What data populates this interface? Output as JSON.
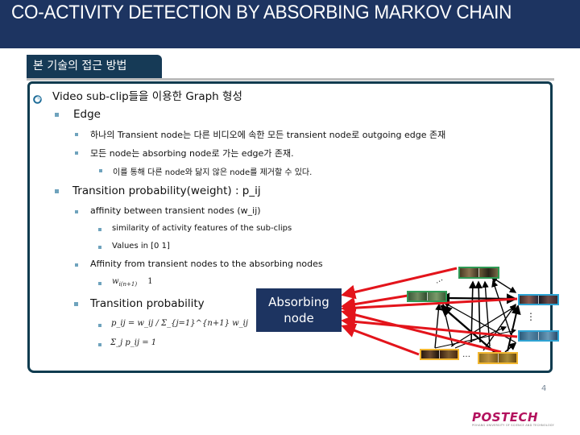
{
  "header": {
    "title": "CO-ACTIVITY DETECTION BY ABSORBING MARKOV CHAIN"
  },
  "section": {
    "tab_label": "본 기술의 접근 방법"
  },
  "content": {
    "main_bullet": "Video sub-clip들을 이용한 Graph 형성",
    "edge": {
      "label": "Edge",
      "items": [
        "하나의 Transient node는 다른 비디오에 속한 모든 transient node로 outgoing edge 존재",
        "모든 node는 absorbing node로 가는 edge가 존재."
      ],
      "sub_items": [
        "이를 통해 다른 node와 닮지 않은 node를 제거할 수 있다."
      ]
    },
    "transition_weight": {
      "label": "Transition probability(weight) : p_ij",
      "affinity_transient": "affinity between transient nodes (w_ij)",
      "affinity_sub": [
        "similarity of activity features of the sub-clips",
        "Values in [0 1]"
      ],
      "affinity_absorbing": "Affinity from transient nodes to the absorbing nodes",
      "absorbing_formula": {
        "lhs": "w",
        "subscript": "i(n+1)",
        "rhs": "1"
      }
    },
    "transition_prob": {
      "label": "Transition probability",
      "formula_1": "p_ij = w_ij / Σ_{j=1}^{n+1} w_ij",
      "formula_2": "Σ_j p_ij = 1"
    }
  },
  "diagram": {
    "absorbing_node_label_1": "Absorbing",
    "absorbing_node_label_2": "node",
    "ellipsis": "…",
    "vertical_ellipsis": "⋮",
    "edge_color_absorbing": "#e3141b",
    "edge_color_transient": "#000000",
    "transient_nodes": [
      {
        "id": "clip-green-top",
        "group": "green",
        "border": "#2f9a55"
      },
      {
        "id": "clip-green-left",
        "group": "green",
        "border": "#2f9a55"
      },
      {
        "id": "clip-blue-top",
        "group": "blue",
        "border": "#2ea3d3"
      },
      {
        "id": "clip-blue-bottom",
        "group": "blue",
        "border": "#2ea3d3"
      },
      {
        "id": "clip-yellow-left",
        "group": "yellow",
        "border": "#f2b731"
      },
      {
        "id": "clip-yellow-right",
        "group": "yellow",
        "border": "#f2b731"
      }
    ]
  },
  "footer": {
    "page_number": "4",
    "logo_text": "POSTECH",
    "logo_subtext": "POHANG UNIVERSITY OF SCIENCE AND TECHNOLOGY"
  },
  "colors": {
    "header_bg": "#1d3461",
    "tab_bg": "#163a56",
    "box_border": "#0f3b4f",
    "bullet": "#6fa3bd",
    "logo": "#b3125e"
  }
}
